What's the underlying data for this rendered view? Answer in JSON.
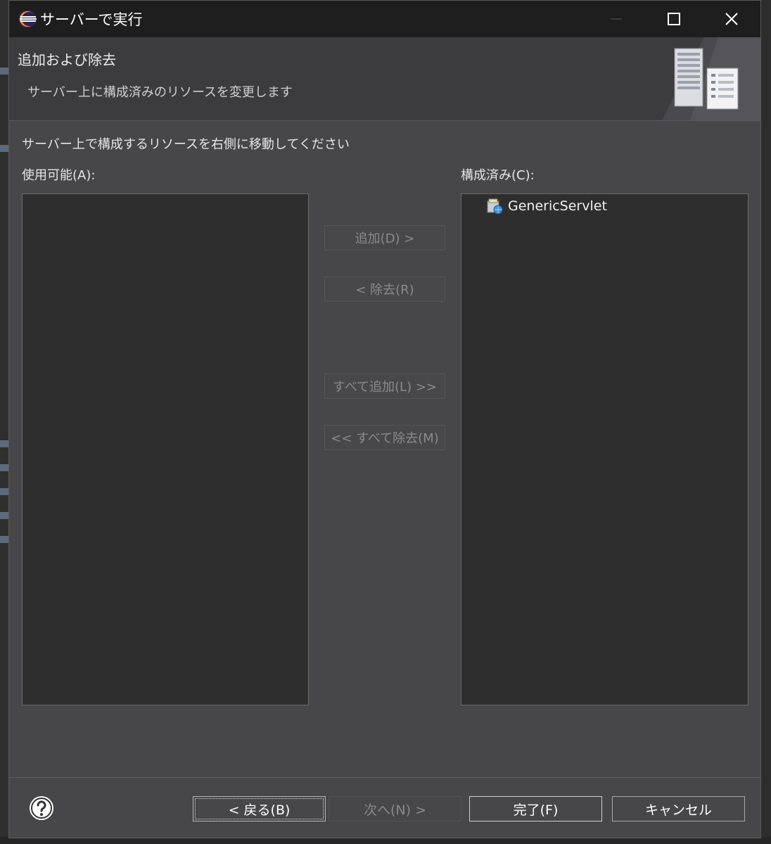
{
  "window": {
    "title": "サーバーで実行"
  },
  "header": {
    "title": "追加および除去",
    "description": "サーバー上に構成済みのリソースを変更します"
  },
  "main": {
    "instruction": "サーバー上で構成するリソースを右側に移動してください",
    "available_label": "使用可能(A):",
    "configured_label": "構成済み(C):",
    "available_items": [],
    "configured_items": [
      {
        "label": "GenericServlet",
        "icon": "web-project-icon"
      }
    ],
    "buttons": {
      "add": "追加(D) >",
      "remove": "< 除去(R)",
      "add_all": "すべて追加(L) >>",
      "remove_all": "<< すべて除去(M)"
    }
  },
  "footer": {
    "back": "< 戻る(B)",
    "next": "次へ(N) >",
    "finish": "完了(F)",
    "cancel": "キャンセル"
  },
  "colors": {
    "titlebar": "#1e1e1e",
    "dialog_bg": "#47474a",
    "list_bg": "#2e2e2e",
    "disabled_text": "#8a8a8a"
  }
}
